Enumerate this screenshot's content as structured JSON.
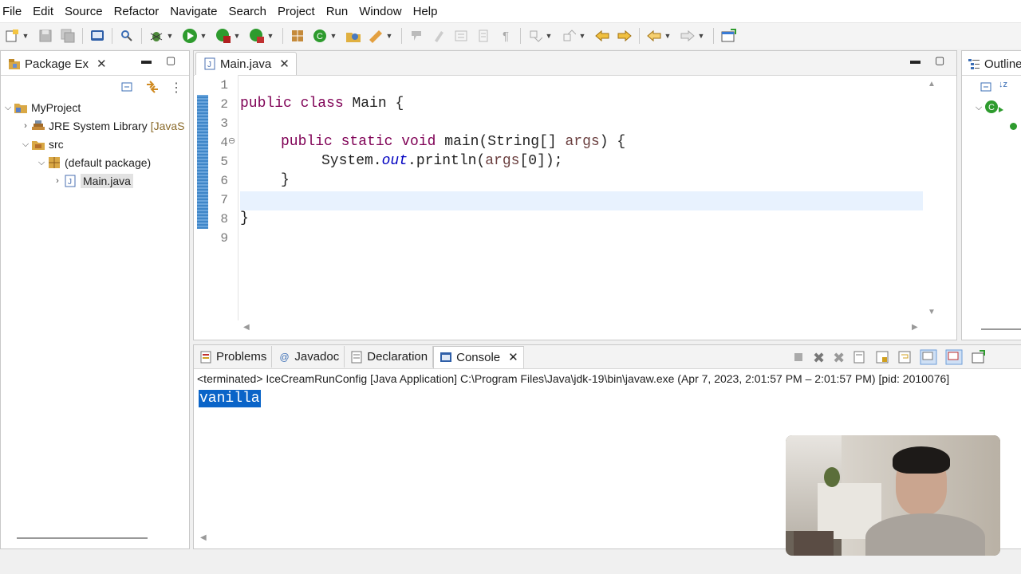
{
  "menu": [
    "File",
    "Edit",
    "Source",
    "Refactor",
    "Navigate",
    "Search",
    "Project",
    "Run",
    "Window",
    "Help"
  ],
  "package_explorer": {
    "tab_label": "Package Ex",
    "close": "✕",
    "tree": {
      "project": "MyProject",
      "jre": "JRE System Library",
      "jre_suffix": "[JavaS",
      "src": "src",
      "package": "(default package)",
      "file": "Main.java"
    }
  },
  "editor": {
    "tab_label": "Main.java",
    "close": "✕",
    "line_numbers": [
      "1",
      "2",
      "3",
      "4",
      "5",
      "6",
      "7",
      "8",
      "9"
    ],
    "fold_marker": "⊖",
    "code": {
      "l2_kw1": "public",
      "l2_kw2": "class",
      "l2_rest": " Main {",
      "l4_kw1": "public",
      "l4_kw2": "static",
      "l4_kw3": "void",
      "l4_rest1": " main(String[] ",
      "l4_var": "args",
      "l4_rest2": ") {",
      "l5_pre": "System.",
      "l5_field": "out",
      "l5_mid": ".println(",
      "l5_var": "args",
      "l5_end": "[0]);",
      "l6": "}",
      "l8": "}"
    }
  },
  "outline": {
    "tab_label": "Outline"
  },
  "bottom_panel": {
    "tabs": [
      {
        "icon": "problems-icon",
        "label": "Problems"
      },
      {
        "icon": "@",
        "label": "Javadoc"
      },
      {
        "icon": "declaration-icon",
        "label": "Declaration"
      },
      {
        "icon": "console-icon",
        "label": "Console"
      }
    ],
    "console_close": "✕",
    "status_line": "<terminated> IceCreamRunConfig [Java Application] C:\\Program Files\\Java\\jdk-19\\bin\\javaw.exe  (Apr 7, 2023, 2:01:57 PM – 2:01:57 PM) [pid: 2010076]",
    "output": "vanilla"
  },
  "colors": {
    "keyword": "#7f0055",
    "field": "#0000c0",
    "variable": "#6a3e3e",
    "selection": "#0a64c8",
    "current_line": "#e8f2fe"
  }
}
